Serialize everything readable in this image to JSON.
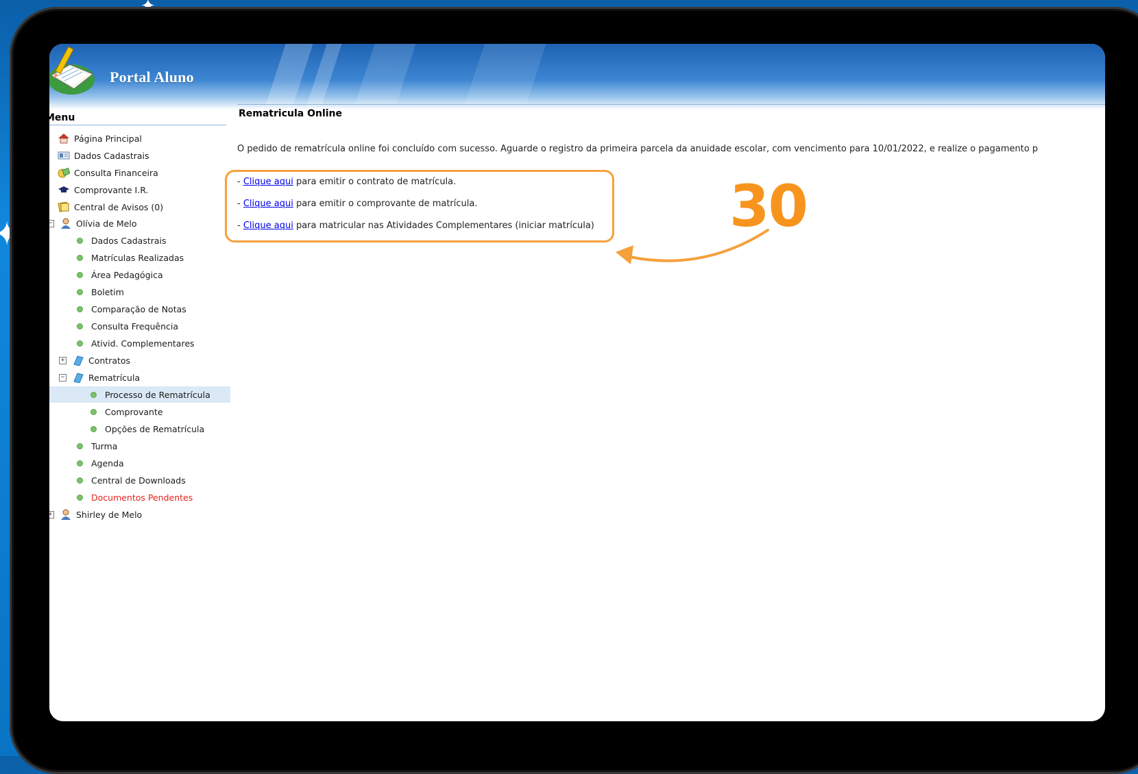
{
  "colors": {
    "accent_orange": "#f7941d",
    "link": "#0000ee",
    "warning_red": "#e3231b",
    "header_blue": "#1d62b3"
  },
  "header": {
    "title": "Portal Aluno",
    "logo_icon": "notebook-pencil-icon"
  },
  "sidebar": {
    "title": "Menu",
    "items": [
      {
        "label": "Página Principal",
        "icon": "home-icon"
      },
      {
        "label": "Dados Cadastrais",
        "icon": "id-card-icon"
      },
      {
        "label": "Consulta Financeira",
        "icon": "money-icon"
      },
      {
        "label": "Comprovante I.R.",
        "icon": "graduation-cap-icon"
      },
      {
        "label": "Central de Avisos (0)",
        "icon": "notes-icon"
      },
      {
        "label": "Olívia de Melo",
        "icon": "student-icon"
      },
      {
        "label": "Dados Cadastrais"
      },
      {
        "label": "Matrículas Realizadas"
      },
      {
        "label": "Área Pedagógica"
      },
      {
        "label": "Boletim"
      },
      {
        "label": "Comparação de Notas"
      },
      {
        "label": "Consulta Frequência"
      },
      {
        "label": "Ativid. Complementares"
      },
      {
        "label": "Contratos",
        "icon": "book-icon"
      },
      {
        "label": "Rematrícula",
        "icon": "book-icon"
      },
      {
        "label": "Processo de Rematrícula"
      },
      {
        "label": "Comprovante"
      },
      {
        "label": "Opções de Rematrícula"
      },
      {
        "label": "Turma"
      },
      {
        "label": "Agenda"
      },
      {
        "label": "Central de Downloads"
      },
      {
        "label": "Documentos Pendentes"
      },
      {
        "label": "Shirley de Melo",
        "icon": "student-icon"
      }
    ]
  },
  "content": {
    "title": "Rematricula Online",
    "message": "O pedido de rematrícula online foi concluído com sucesso. Aguarde o registro da primeira parcela da anuidade escolar, com vencimento para 10/01/2022, e realize o pagamento p",
    "links": [
      {
        "link_text": "Clique aqui",
        "rest": " para emitir o contrato de matrícula."
      },
      {
        "link_text": "Clique aqui",
        "rest": " para emitir o comprovante de matrícula."
      },
      {
        "link_text": "Clique aqui",
        "rest": " para matricular nas Atividades Complementares (iniciar matrícula)"
      }
    ],
    "dash": "- "
  },
  "annotation": {
    "step_number": "30"
  }
}
